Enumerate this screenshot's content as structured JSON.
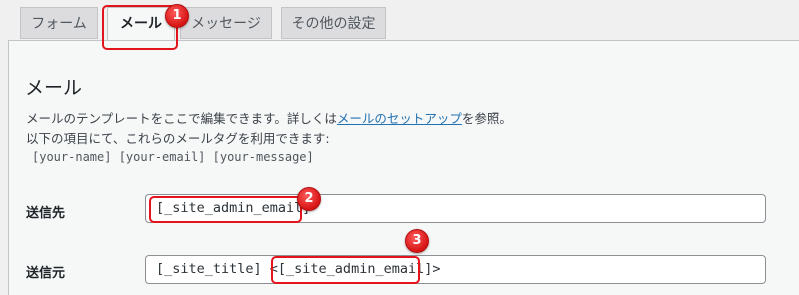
{
  "tabs": [
    "フォーム",
    "メール",
    "メッセージ",
    "その他の設定"
  ],
  "section_title": "メール",
  "description": {
    "line1_before": "メールのテンプレートをここで編集できます。詳しくは",
    "line1_link": "メールのセットアップ",
    "line1_after": "を参照。",
    "line2": "以下の項目にて、これらのメールタグを利用できます:",
    "tags": "[your-name] [your-email] [your-message]"
  },
  "fields": {
    "to": {
      "label": "送信先",
      "value": "[_site_admin_email]"
    },
    "from": {
      "label": "送信元",
      "value": "[_site_title] <[_site_admin_email]>"
    }
  },
  "annotations": [
    "1",
    "2",
    "3"
  ],
  "colors": {
    "annotation": "#e3141c",
    "link": "#2271b1"
  }
}
